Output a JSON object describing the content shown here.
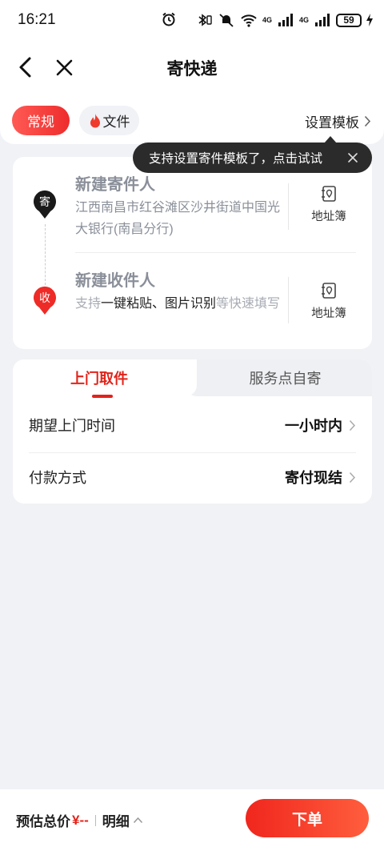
{
  "status_bar": {
    "time": "16:21",
    "net1": "4G",
    "net2": "4G",
    "battery": "59"
  },
  "nav": {
    "title": "寄快递"
  },
  "type_chips": {
    "regular": "常规",
    "document": "文件"
  },
  "template_link": "设置模板",
  "tooltip": {
    "text": "支持设置寄件模板了，点击试试"
  },
  "sender": {
    "pin_label": "寄",
    "title": "新建寄件人",
    "address": "江西南昌市红谷滩区沙井街道中国光大银行(南昌分行)",
    "book_label": "地址簿"
  },
  "receiver": {
    "pin_label": "收",
    "title": "新建收件人",
    "hint_prefix": "支持",
    "hint_highlight": "一键粘贴、图片识别",
    "hint_suffix": "等快速填写",
    "book_label": "地址簿"
  },
  "pickup": {
    "tab_home": "上门取件",
    "tab_station": "服务点自寄",
    "time_label": "期望上门时间",
    "time_value": "一小时内",
    "payment_label": "付款方式",
    "payment_value": "寄付现结"
  },
  "bottom_bar": {
    "estimate_label": "预估总价",
    "price": "¥--",
    "detail_label": "明细",
    "order_button": "下单"
  },
  "colors": {
    "accent": "#e2231a",
    "background": "#f1f2f6",
    "tooltip_bg": "#2b2b2b"
  }
}
